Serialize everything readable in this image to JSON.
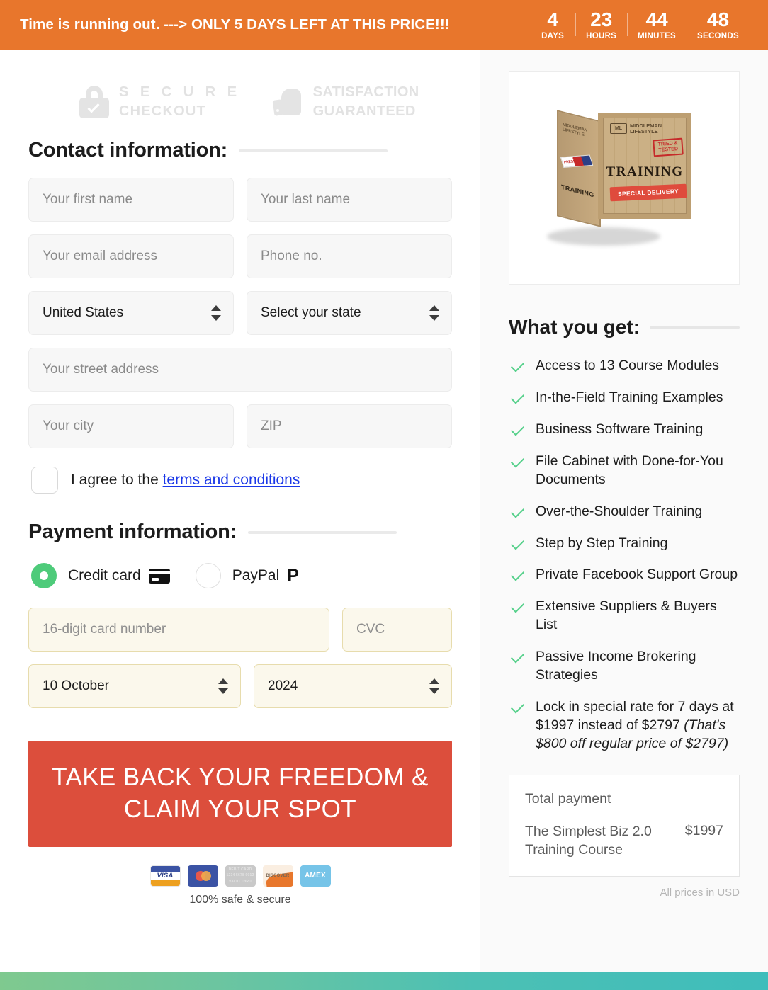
{
  "countdown": {
    "message": "Time is running out. ---> ONLY 5 DAYS LEFT AT THIS PRICE!!!",
    "units": [
      {
        "value": "4",
        "label": "DAYS"
      },
      {
        "value": "23",
        "label": "HOURS"
      },
      {
        "value": "44",
        "label": "MINUTES"
      },
      {
        "value": "48",
        "label": "SECONDS"
      }
    ],
    "bg_color": "#e8762c"
  },
  "trust": {
    "secure_line1": "S E C U R E",
    "secure_line2": "CHECKOUT",
    "satisfaction_line1": "SATISFACTION",
    "satisfaction_line2": "GUARANTEED"
  },
  "contact": {
    "heading": "Contact information:",
    "first_name_placeholder": "Your first name",
    "last_name_placeholder": "Your last name",
    "email_placeholder": "Your email address",
    "phone_placeholder": "Phone no.",
    "country_value": "United States",
    "state_value": "Select your state",
    "street_placeholder": "Your street address",
    "city_placeholder": "Your city",
    "zip_placeholder": "ZIP",
    "terms_prefix": "I agree to the ",
    "terms_link": "terms and conditions"
  },
  "payment": {
    "heading": "Payment information:",
    "credit_card_label": "Credit card",
    "paypal_label": "PayPal",
    "selected_method": "Credit card",
    "card_number_placeholder": "16-digit card number",
    "cvc_placeholder": "CVC",
    "expiry_month_value": "10 October",
    "expiry_year_value": "2024",
    "cta_label": "TAKE BACK YOUR FREEDOM & CLAIM YOUR SPOT",
    "cta_color": "#dc4e3c",
    "safe_note": "100% safe & secure",
    "cards": [
      {
        "name": "VISA"
      },
      {
        "name": "Mastercard"
      },
      {
        "name": "Generic card"
      },
      {
        "name": "DISCOVER"
      },
      {
        "name": "AMEX"
      }
    ],
    "visa_label": "VISA",
    "generic_label": "DEBIT CARD 1234 5678 9012 VALID THRU",
    "discover_label": "DISCOVER",
    "amex_label": "AMEX"
  },
  "product": {
    "crate_side_logo": "MIDDLEMAN LIFESTYLE",
    "crate_side_training": "TRAINING",
    "crate_side_stamp": "PRESS",
    "crate_badge": "ML",
    "crate_brand_line1": "MIDDLEMAN",
    "crate_brand_line2": "LIFESTYLE",
    "crate_tried": "TRIED & TESTED",
    "crate_training": "TRAINING",
    "crate_delivery": "SPECIAL DELIVERY"
  },
  "what_you_get": {
    "heading": "What you get:",
    "items": [
      {
        "text": "Access to 13 Course Modules"
      },
      {
        "text": "In-the-Field Training Examples"
      },
      {
        "text": "Business Software Training"
      },
      {
        "text": "File Cabinet with Done-for-You Documents"
      },
      {
        "text": "Over-the-Shoulder Training"
      },
      {
        "text": "Step by Step Training"
      },
      {
        "text": "Private Facebook Support Group"
      },
      {
        "text": "Extensive Suppliers & Buyers List"
      },
      {
        "text": "Passive Income Brokering Strategies"
      },
      {
        "text": "Lock in special rate for 7 days at $1997 instead of $2797 ",
        "italic": "(That's $800 off regular price of $2797)"
      }
    ]
  },
  "total": {
    "title": "Total payment",
    "item": "The Simplest Biz 2.0 Training Course",
    "price": "$1997",
    "currency_note": "All prices in USD"
  }
}
